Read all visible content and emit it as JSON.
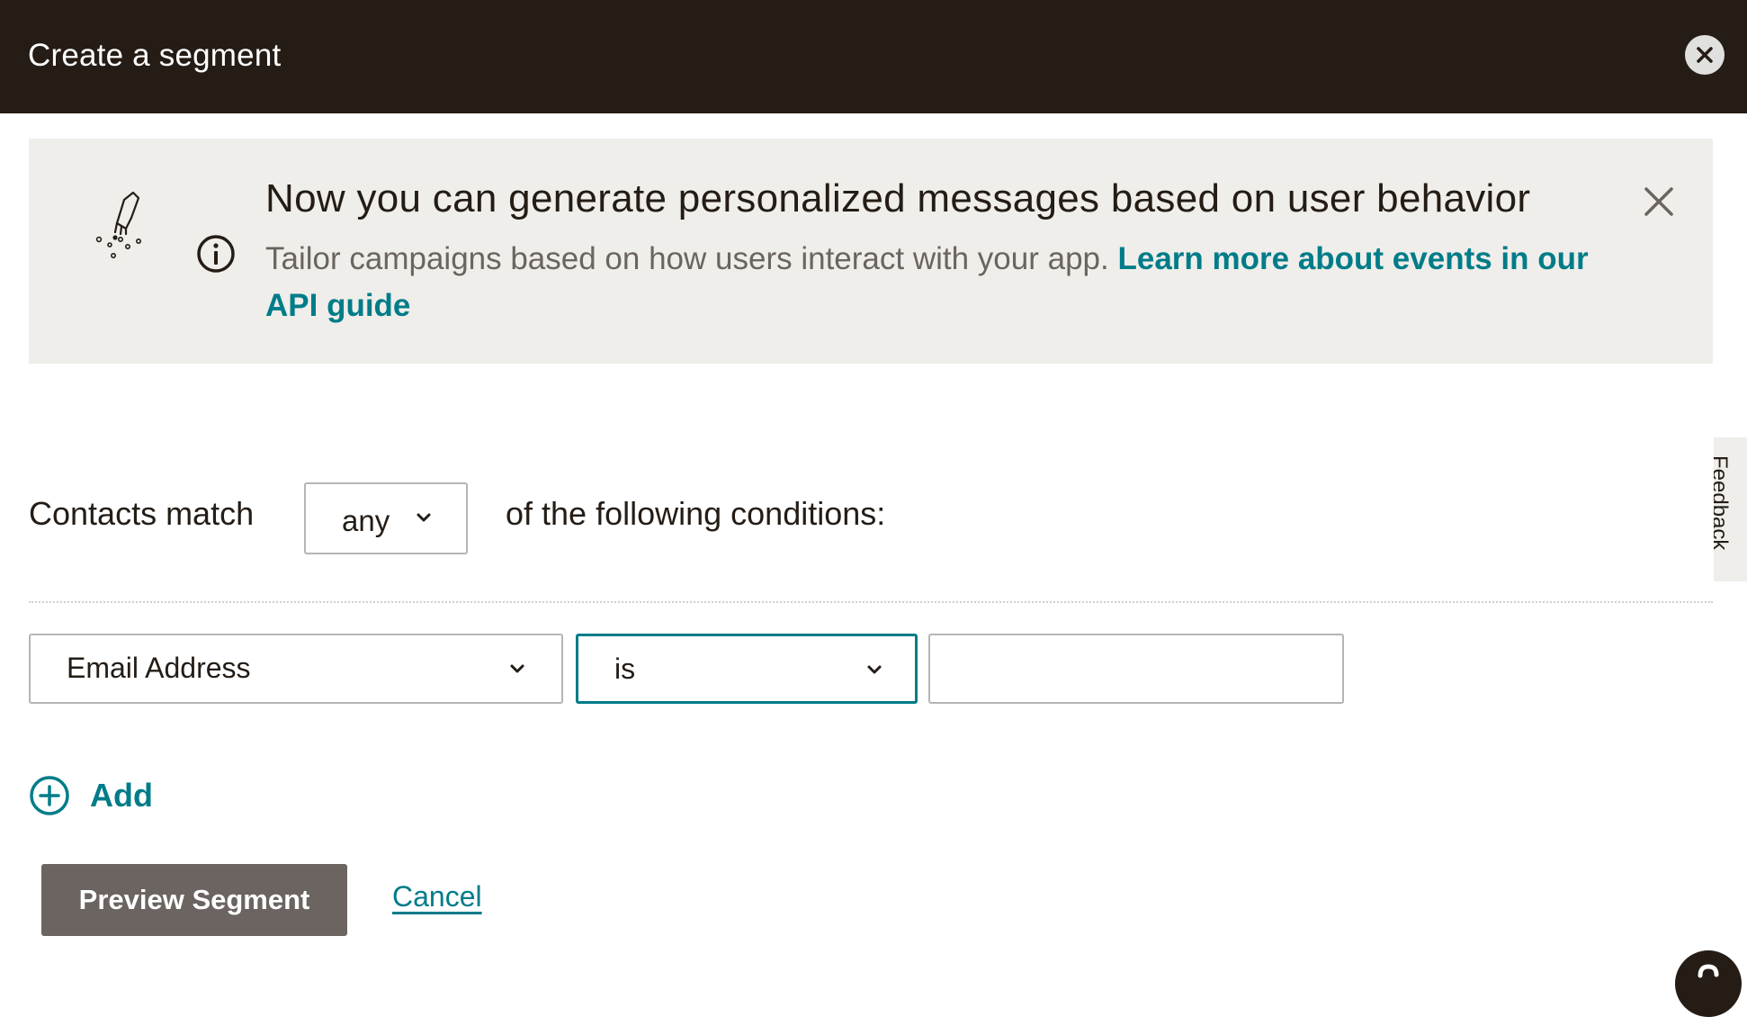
{
  "header": {
    "title": "Create a segment",
    "close_icon": "close-icon"
  },
  "banner": {
    "illustration": "hand-sprinkle-illustration",
    "info_icon": "info-circle-icon",
    "heading": "Now you can generate personalized messages based on user behavior",
    "body_text": "Tailor campaigns based on how users interact with your app.",
    "link_text": "Learn more about events in our API guide",
    "dismiss_icon": "close-icon"
  },
  "conditions": {
    "match_prefix": "Contacts match",
    "match_value": "any",
    "match_suffix": "of the following conditions:",
    "rows": [
      {
        "field": "Email Address",
        "operator": "is",
        "value": ""
      }
    ]
  },
  "actions": {
    "add_label": "Add",
    "add_icon": "plus-circle-icon",
    "preview_label": "Preview Segment",
    "cancel_label": "Cancel"
  },
  "feedback_tab": {
    "label": "Feedback"
  },
  "colors": {
    "header_bg": "#241c15",
    "banner_bg": "#efeeea",
    "accent": "#007c89",
    "preview_button_bg": "#6b6461",
    "border": "#b5b5b3"
  }
}
